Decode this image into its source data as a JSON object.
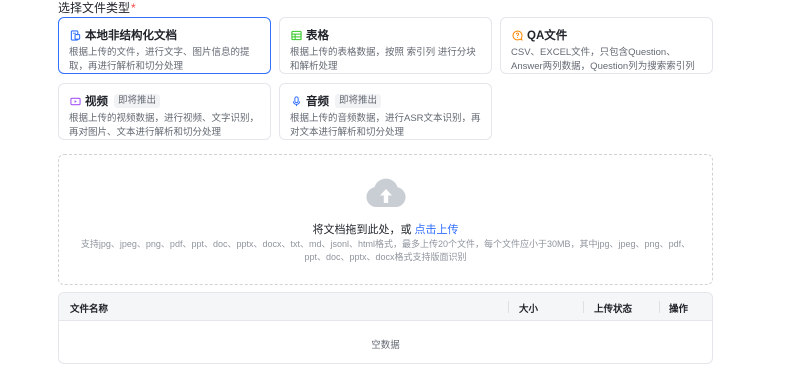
{
  "form": {
    "label": "选择文件类型",
    "required_mark": "*"
  },
  "cards": [
    {
      "title": "本地非结构化文档",
      "desc": "根据上传的文件，进行文字、图片信息的提取，再进行解析和切分处理",
      "icon": "document-icon",
      "icon_color": "#3370ff",
      "selected": true,
      "badge": ""
    },
    {
      "title": "表格",
      "desc": "根据上传的表格数据，按照 索引列 进行分块和解析处理",
      "icon": "table-icon",
      "icon_color": "#34c724",
      "selected": false,
      "badge": ""
    },
    {
      "title": "QA文件",
      "desc": "CSV、EXCEL文件，只包含Question、Answer两列数据，Question列为搜索索引列",
      "icon": "qa-chat-icon",
      "icon_color": "#ff8800",
      "selected": false,
      "badge": ""
    },
    {
      "title": "视频",
      "desc": "根据上传的视频数据，进行视频、文字识别，再对图片、文本进行解析和切分处理",
      "icon": "video-icon",
      "icon_color": "#a855f7",
      "selected": false,
      "badge": "即将推出"
    },
    {
      "title": "音频",
      "desc": "根据上传的音频数据，进行ASR文本识别，再对文本进行解析和切分处理",
      "icon": "microphone-icon",
      "icon_color": "#3370ff",
      "selected": false,
      "badge": "即将推出"
    }
  ],
  "upload": {
    "main_text": "将文档拖到此处，或",
    "link_text": "点击上传",
    "hint": "支持jpg、jpeg、png、pdf、ppt、doc、pptx、docx、txt、md、jsonl、html格式，最多上传20个文件，每个文件应小于30MB，其中jpg、jpeg、png、pdf、ppt、doc、pptx、docx格式支持版面识别",
    "icon": "cloud-upload-icon"
  },
  "table": {
    "columns": [
      "文件名称",
      "大小",
      "上传状态",
      "操作"
    ],
    "empty_text": "空数据"
  }
}
